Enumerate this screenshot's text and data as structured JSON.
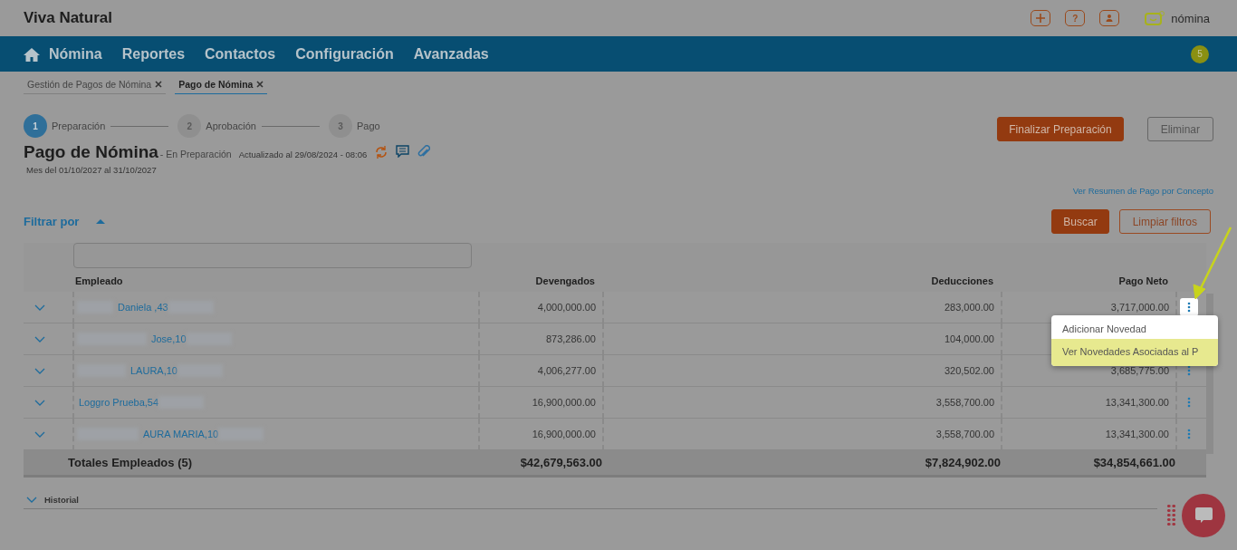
{
  "header": {
    "title": "Viva Natural",
    "brand": "nómina",
    "help_label": "?"
  },
  "nav": {
    "items": [
      {
        "label": "Nómina",
        "kind": "home"
      },
      {
        "label": "Reportes",
        "kind": "plain"
      },
      {
        "label": "Contactos",
        "kind": "plain"
      },
      {
        "label": "Configuración",
        "kind": "plain"
      },
      {
        "label": "Avanzadas",
        "kind": "plain"
      }
    ],
    "badge": "5"
  },
  "breadcrumbs": [
    {
      "label": "Gestión de Pagos de Nómina",
      "selected": false
    },
    {
      "label": "Pago de Nómina",
      "selected": true
    }
  ],
  "stepper": [
    {
      "number": "1",
      "label": "Preparación",
      "current": true
    },
    {
      "number": "2",
      "label": "Aprobación",
      "current": false
    },
    {
      "number": "3",
      "label": "Pago",
      "current": false
    }
  ],
  "page": {
    "title": "Pago de Nómina",
    "status": "- En Preparación",
    "updated": "Actualizado al 29/08/2024 - 08:06",
    "period": "Mes del 01/10/2027 al 31/10/2027"
  },
  "actions": [
    {
      "label": "Finalizar Preparación",
      "kind": "primary"
    },
    {
      "label": "Eliminar",
      "kind": "outline"
    }
  ],
  "summary_link": "Ver Resumen de Pago por Concepto",
  "filter": {
    "label": "Filtrar por",
    "expanded": true,
    "buttons": [
      {
        "label": "Buscar",
        "kind": "primary"
      },
      {
        "label": "Limpiar filtros",
        "kind": "outline"
      }
    ]
  },
  "table": {
    "columns": [
      "Empleado",
      "Devengados",
      "Deducciones",
      "Pago Neto"
    ],
    "rows": [
      {
        "name": "Daniela ,43",
        "redacted_before": true,
        "devengados": "4,000,000.00",
        "deducciones": "283,000.00",
        "pago_neto": "3,717,000.00",
        "menu_open": true
      },
      {
        "name": "Jose,10",
        "redacted_before": true,
        "devengados": "873,286.00",
        "deducciones": "104,000.00",
        "pago_neto": "",
        "menu_open": false
      },
      {
        "name": "LAURA,10",
        "redacted_before": true,
        "devengados": "4,006,277.00",
        "deducciones": "320,502.00",
        "pago_neto": "3,685,775.00",
        "menu_open": false
      },
      {
        "name": "Loggro Prueba,54",
        "redacted_before": false,
        "devengados": "16,900,000.00",
        "deducciones": "3,558,700.00",
        "pago_neto": "13,341,300.00",
        "menu_open": false
      },
      {
        "name": "AURA MARIA,10",
        "redacted_before": true,
        "devengados": "16,900,000.00",
        "deducciones": "3,558,700.00",
        "pago_neto": "13,341,300.00",
        "menu_open": false
      }
    ],
    "totals": {
      "label": "Totales Empleados (5)",
      "devengados": "$42,679,563.00",
      "deducciones": "$7,824,902.00",
      "pago_neto": "$34,854,661.00"
    }
  },
  "row_menu": [
    {
      "label": "Adicionar Novedad",
      "selected": false
    },
    {
      "label": "Ver Novedades Asociadas al P",
      "selected": true
    }
  ],
  "history": {
    "label": "Historial",
    "expanded": false
  }
}
